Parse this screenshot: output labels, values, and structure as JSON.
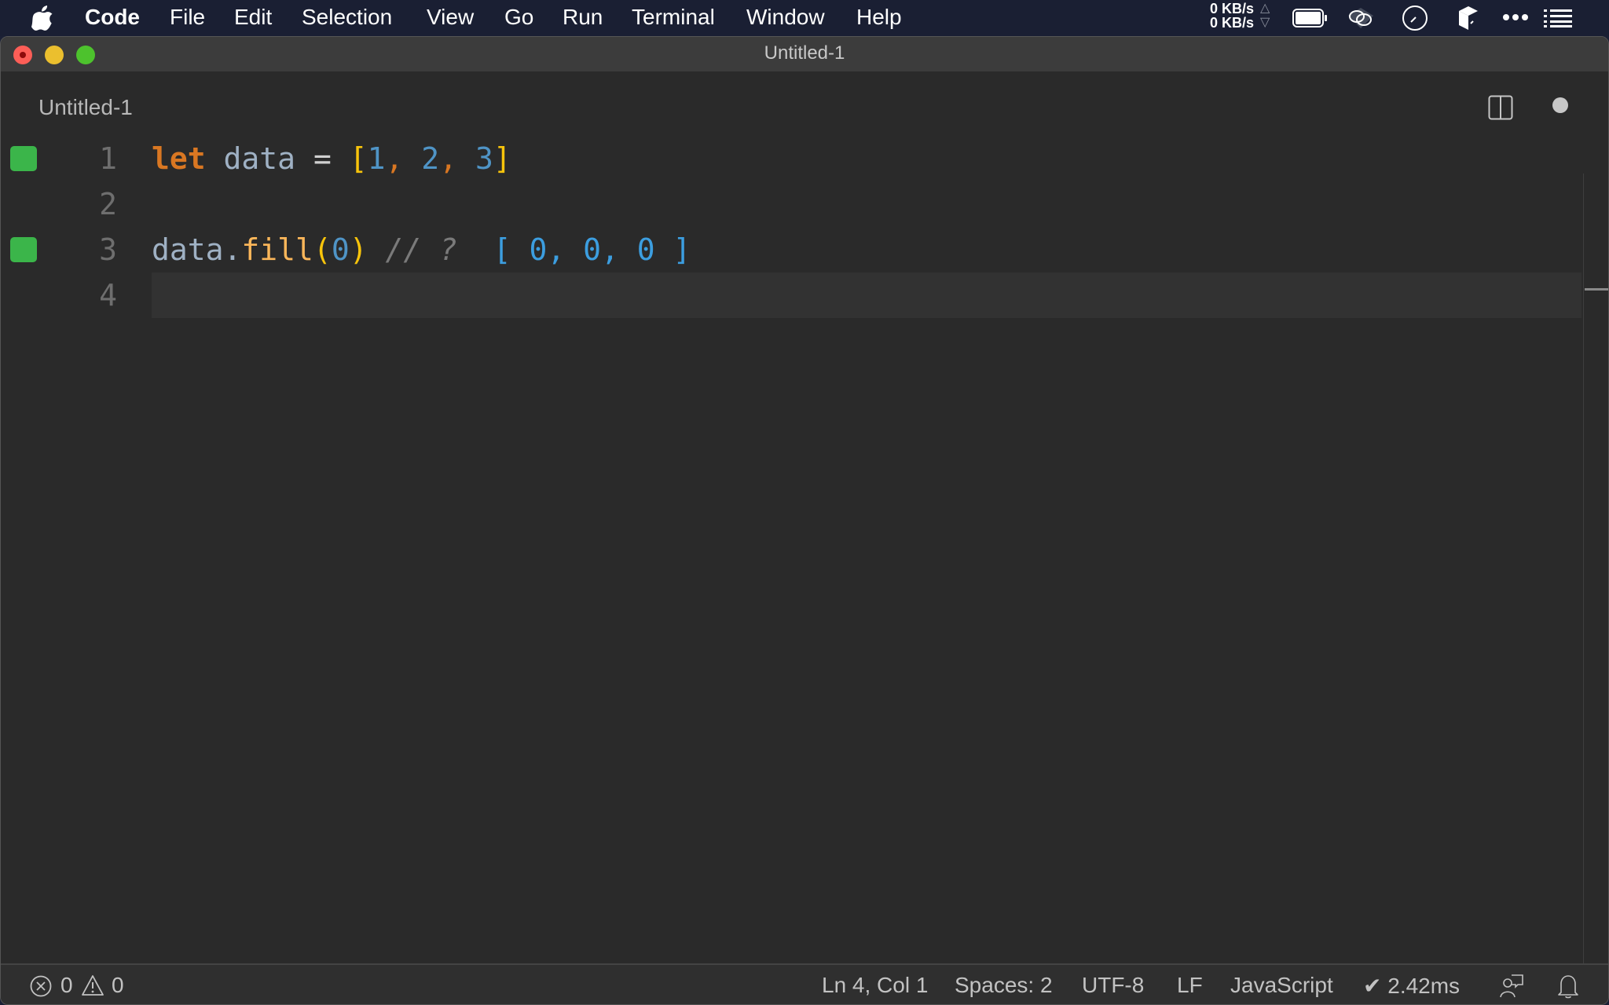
{
  "menubar": {
    "app_name": "Code",
    "items": [
      "File",
      "Edit",
      "Selection",
      "View",
      "Go",
      "Run",
      "Terminal",
      "Window",
      "Help"
    ],
    "net_up": "0 KB/s",
    "net_down": "0 KB/s",
    "tray_icons": [
      "battery-icon",
      "creative-cloud-icon",
      "clock-icon",
      "box-icon",
      "more-icon",
      "list-icon"
    ]
  },
  "window": {
    "title": "Untitled-1"
  },
  "tab": {
    "label": "Untitled-1",
    "unsaved": true
  },
  "editor": {
    "lines": [
      {
        "number": "1",
        "marker": true,
        "code": "let data = [1, 2, 3]"
      },
      {
        "number": "2",
        "marker": false,
        "code": ""
      },
      {
        "number": "3",
        "marker": true,
        "code": "data.fill(0) // ?  [ 0, 0, 0 ]"
      },
      {
        "number": "4",
        "marker": false,
        "code": ""
      }
    ],
    "tokens": {
      "l1_kw": "let",
      "l1_id": "data",
      "l1_op": "=",
      "l1_open": "[",
      "l1_n1": "1",
      "l1_n2": "2",
      "l1_n3": "3",
      "l1_comma": ",",
      "l1_close": "]",
      "l3_id": "data",
      "l3_dot": ".",
      "l3_fn": "fill",
      "l3_open": "(",
      "l3_arg": "0",
      "l3_close": ")",
      "l3_comment": "// ?",
      "l3_result": "[ 0, 0, 0 ]"
    },
    "gutter_marker_color": "#3bb54a",
    "current_line": 4
  },
  "statusbar": {
    "errors": "0",
    "warnings": "0",
    "cursor": "Ln 4, Col 1",
    "indent": "Spaces: 2",
    "encoding": "UTF-8",
    "eol": "LF",
    "language": "JavaScript",
    "timing": "✔ 2.42ms"
  }
}
